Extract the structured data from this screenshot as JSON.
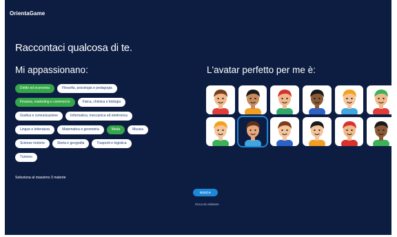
{
  "app": {
    "title": "OrientaGame"
  },
  "header": {
    "intro": "Raccontaci qualcosa di te.",
    "interests_title": "Mi appassionano:",
    "avatar_title": "L'avatar perfetto per me è:"
  },
  "chips": [
    [
      {
        "label": "Diritto ed economia",
        "selected": true
      },
      {
        "label": "Filosofia, psicologia e pedagogia",
        "selected": false
      }
    ],
    [
      {
        "label": "Finanza, marketing e commercio",
        "selected": true
      },
      {
        "label": "Fisica, chimica e biologia",
        "selected": false
      }
    ],
    [
      {
        "label": "Grafica e comunicazione",
        "selected": false
      },
      {
        "label": "Informatica, meccanica ed elettronica",
        "selected": false
      }
    ],
    [
      {
        "label": "Lingue e letteratura",
        "selected": false
      },
      {
        "label": "Matematica e geometria",
        "selected": false
      },
      {
        "label": "Moda",
        "selected": true
      },
      {
        "label": "Musica",
        "selected": false
      }
    ],
    [
      {
        "label": "Scienze motorie",
        "selected": false
      },
      {
        "label": "Storia e geografia",
        "selected": false
      },
      {
        "label": "Trasporti e logistica",
        "selected": false
      }
    ],
    [
      {
        "label": "Turismo",
        "selected": false
      }
    ]
  ],
  "hint": "Seleziona al massimo 3 materie",
  "play_button": "GIOCA",
  "skip_link": "Gioca da visitatore",
  "avatars": {
    "selected_index": 7,
    "items": [
      {
        "icon": "avatar-curly-brown-hair-icon",
        "bg": "#ffffff",
        "skin": "#f1b98a",
        "hair": "#7a3d1d",
        "shirt": "#e23b3b"
      },
      {
        "icon": "avatar-long-black-hair-icon",
        "bg": "#ffffff",
        "skin": "#c78a5c",
        "hair": "#1a1a1a",
        "shirt": "#f29e22"
      },
      {
        "icon": "avatar-red-ponytail-icon",
        "bg": "#ffffff",
        "skin": "#f1b98a",
        "hair": "#d6332e",
        "shirt": "#2faa6b"
      },
      {
        "icon": "avatar-dark-short-hair-icon",
        "bg": "#ffffff",
        "skin": "#8a5a37",
        "hair": "#1a1a1a",
        "shirt": "#2a62c8"
      },
      {
        "icon": "avatar-blonde-boy-icon",
        "bg": "#ffffff",
        "skin": "#f5c49a",
        "hair": "#f2a21e",
        "shirt": "#3fa6e0"
      },
      {
        "icon": "avatar-green-cap-icon",
        "bg": "#ffffff",
        "skin": "#f1b98a",
        "hair": "#3bb15a",
        "shirt": "#e23b3b"
      },
      {
        "icon": "avatar-orange-hair-boy-icon",
        "bg": "#ffffff",
        "skin": "#f5c49a",
        "hair": "#f2a21e",
        "shirt": "#3bb15a"
      },
      {
        "icon": "avatar-brown-hair-girl-icon",
        "bg": "#0d1d42",
        "skin": "#e8a77c",
        "hair": "#5a3420",
        "shirt": "#3fa6e0"
      },
      {
        "icon": "avatar-hipster-boy-icon",
        "bg": "#ffffff",
        "skin": "#f5c49a",
        "hair": "#7a3d1d",
        "shirt": "#2a62c8"
      },
      {
        "icon": "avatar-black-bob-girl-icon",
        "bg": "#ffffff",
        "skin": "#f5c49a",
        "hair": "#1a1a1a",
        "shirt": "#f29e22"
      },
      {
        "icon": "avatar-red-beard-icon",
        "bg": "#ffffff",
        "skin": "#f1b98a",
        "hair": "#d6332e",
        "shirt": "#d6332e"
      },
      {
        "icon": "avatar-curly-black-hair-icon",
        "bg": "#ffffff",
        "skin": "#8a5a37",
        "hair": "#1a1a1a",
        "shirt": "#3bb15a"
      }
    ]
  },
  "colors": {
    "background": "#0d1d42",
    "accent": "#36a64a",
    "button": "#1e88d8"
  }
}
